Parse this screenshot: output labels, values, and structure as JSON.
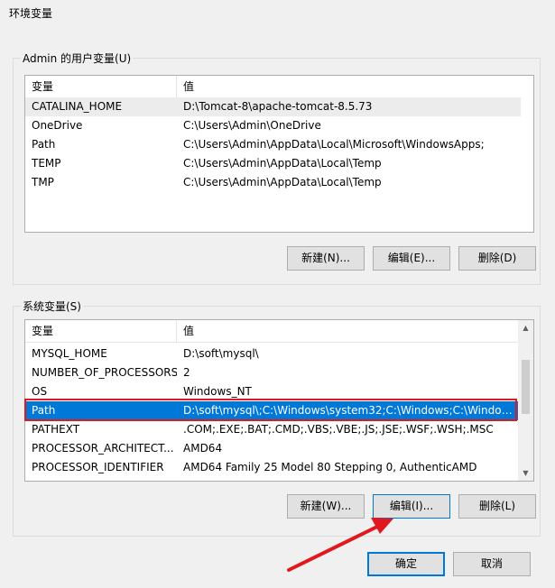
{
  "window": {
    "title": "环境变量"
  },
  "user_vars": {
    "group_label": "Admin 的用户变量(U)",
    "columns": [
      "变量",
      "值"
    ],
    "rows": [
      {
        "name": "CATALINA_HOME",
        "value": "D:\\Tomcat-8\\apache-tomcat-8.5.73"
      },
      {
        "name": "OneDrive",
        "value": "C:\\Users\\Admin\\OneDrive"
      },
      {
        "name": "Path",
        "value": "C:\\Users\\Admin\\AppData\\Local\\Microsoft\\WindowsApps;"
      },
      {
        "name": "TEMP",
        "value": "C:\\Users\\Admin\\AppData\\Local\\Temp"
      },
      {
        "name": "TMP",
        "value": "C:\\Users\\Admin\\AppData\\Local\\Temp"
      }
    ],
    "buttons": {
      "new": "新建(N)...",
      "edit": "编辑(E)...",
      "delete": "删除(D)"
    }
  },
  "system_vars": {
    "group_label": "系统变量(S)",
    "columns": [
      "变量",
      "值"
    ],
    "rows": [
      {
        "name": "MYSQL_HOME",
        "value": "D:\\soft\\mysql\\"
      },
      {
        "name": "NUMBER_OF_PROCESSORS",
        "value": "2"
      },
      {
        "name": "OS",
        "value": "Windows_NT"
      },
      {
        "name": "Path",
        "value": "D:\\soft\\mysql\\;C:\\Windows\\system32;C:\\Windows;C:\\Window..."
      },
      {
        "name": "PATHEXT",
        "value": ".COM;.EXE;.BAT;.CMD;.VBS;.VBE;.JS;.JSE;.WSF;.WSH;.MSC"
      },
      {
        "name": "PROCESSOR_ARCHITECT...",
        "value": "AMD64"
      },
      {
        "name": "PROCESSOR_IDENTIFIER",
        "value": "AMD64 Family 25 Model 80 Stepping 0, AuthenticAMD"
      }
    ],
    "selected_row": "Path",
    "buttons": {
      "new": "新建(W)...",
      "edit": "编辑(I)...",
      "delete": "删除(L)"
    }
  },
  "footer": {
    "ok": "确定",
    "cancel": "取消"
  },
  "colors": {
    "selection": "#0078d7",
    "annotation": "#e1191f",
    "accent_border": "#0078d7"
  },
  "icons": {
    "scroll_up": "chevron-up-icon",
    "scroll_down": "chevron-down-icon",
    "annotation": "red-arrow-annotation"
  }
}
